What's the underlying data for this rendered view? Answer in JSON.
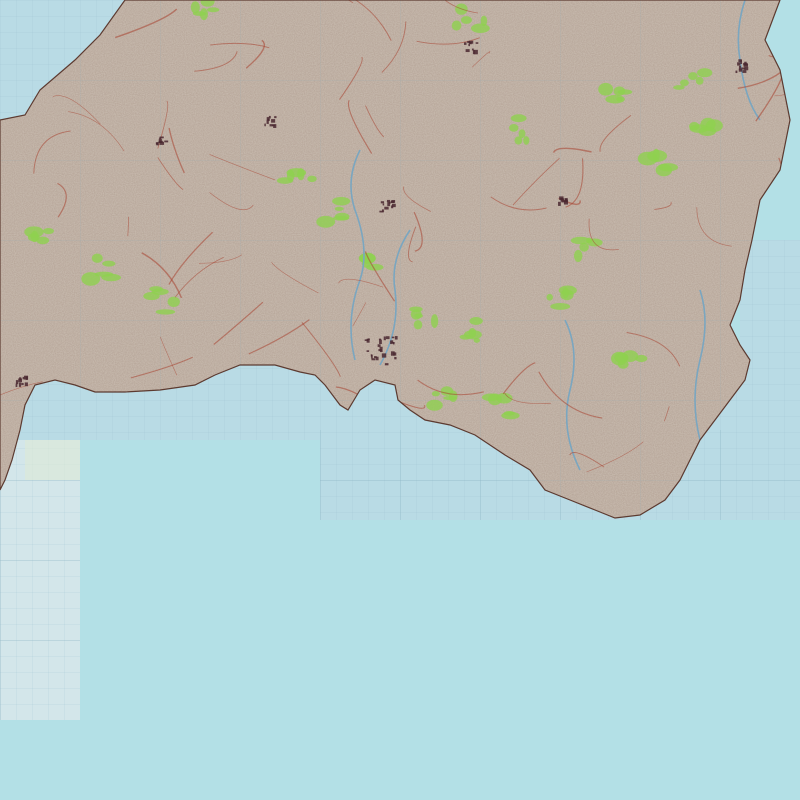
{
  "map": {
    "type": "topographic-tile-mosaic",
    "colors": {
      "sea": "#b3e0e6",
      "tile_sea": "#b9dbe5",
      "tile_sea_pale": "#d3e6ea",
      "grid_line": "#8fb8c8",
      "land": "#cbbfb3",
      "land_dark": "#b5a698",
      "land_light": "#e4dbd2",
      "woodland": "#8fd14f",
      "road": "#a8412f",
      "river": "#7aa6c0",
      "town": "#4a2830",
      "coast": "#5c3a30"
    }
  }
}
